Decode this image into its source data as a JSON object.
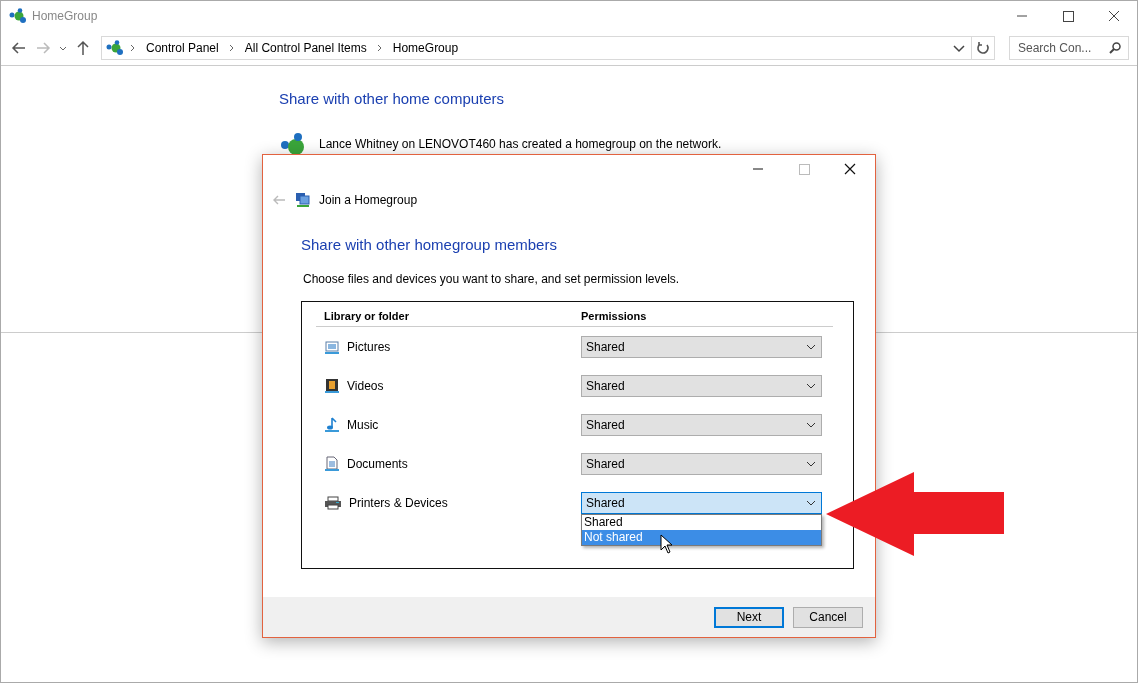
{
  "window": {
    "title": "HomeGroup"
  },
  "address_bar": {
    "breadcrumbs": [
      "Control Panel",
      "All Control Panel Items",
      "HomeGroup"
    ],
    "search": {
      "placeholder": "Search Con..."
    }
  },
  "content": {
    "heading": "Share with other home computers",
    "message": "Lance Whitney on LENOVOT460 has created a homegroup on the network."
  },
  "dialog": {
    "title": "Join a Homegroup",
    "heading": "Share with other homegroup members",
    "description": "Choose files and devices you want to share, and set permission levels.",
    "columns": [
      "Library or folder",
      "Permissions"
    ],
    "rows": [
      {
        "kind": "pictures",
        "label": "Pictures",
        "permission": "Shared",
        "open": false
      },
      {
        "kind": "videos",
        "label": "Videos",
        "permission": "Shared",
        "open": false
      },
      {
        "kind": "music",
        "label": "Music",
        "permission": "Shared",
        "open": false
      },
      {
        "kind": "documents",
        "label": "Documents",
        "permission": "Shared",
        "open": false
      },
      {
        "kind": "printers",
        "label": "Printers & Devices",
        "permission": "Shared",
        "open": true,
        "options": [
          {
            "label": "Shared",
            "selected": false
          },
          {
            "label": "Not shared",
            "selected": true
          }
        ]
      }
    ],
    "buttons": [
      {
        "label": "Next",
        "default": true
      },
      {
        "label": "Cancel",
        "default": false
      }
    ]
  }
}
